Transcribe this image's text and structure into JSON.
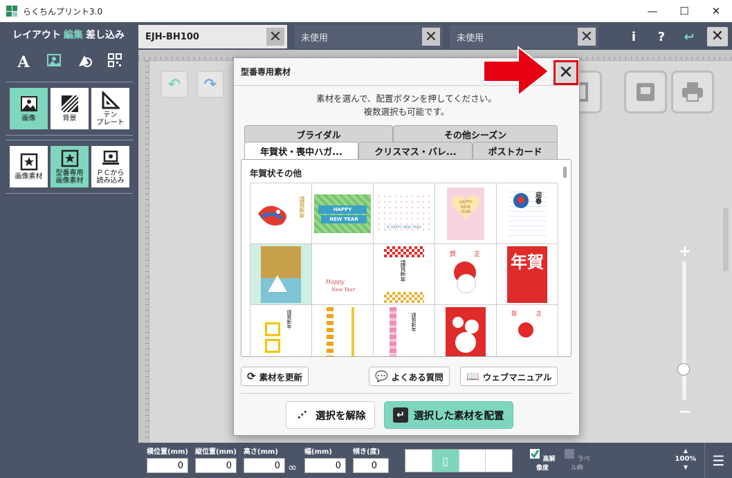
{
  "window": {
    "title": "らくちんプリント3.0",
    "controls": [
      "—",
      "☐",
      "✕"
    ]
  },
  "left_panel": {
    "mode_tabs": [
      {
        "label": "レイアウト",
        "active": false
      },
      {
        "label": "編集",
        "active": true
      },
      {
        "label": "差し込み",
        "active": false
      }
    ],
    "tool_icons": [
      "text-icon",
      "image-edit-icon",
      "shape-icon",
      "qr-code-icon"
    ],
    "group1": [
      {
        "label": "画像",
        "active": true
      },
      {
        "label": "背景",
        "active": false
      },
      {
        "label": "テン\nプレート",
        "active": false
      }
    ],
    "group2": [
      {
        "label": "画像素材",
        "active": false
      },
      {
        "label": "型番専用\n画像素材",
        "active": true
      },
      {
        "label": "ＰＣから\n読み込み",
        "active": false
      }
    ]
  },
  "doc_tabs": [
    {
      "label": "EJH-BH100",
      "active": true
    },
    {
      "label": "未使用",
      "active": false
    },
    {
      "label": "未使用",
      "active": false
    }
  ],
  "top_right_buttons": [
    "i",
    "?",
    "↩",
    "✕"
  ],
  "dialog": {
    "title": "型番専用素材",
    "message_line1": "素材を選んで、配置ボタンを押してください。",
    "message_line2": "複数選択も可能です。",
    "tabs_row1": [
      "ブライダル",
      "その他シーズン"
    ],
    "tabs_row2": [
      "年賀状・喪中ハガ...",
      "クリスマス・バレ...",
      "ポストカード"
    ],
    "active_tab": "年賀状・喪中ハガ...",
    "section_heading": "年賀状その他",
    "thumbnails": [
      {
        "kind": "koi",
        "text": "謹賀新年"
      },
      {
        "kind": "green-banner",
        "line1": "HAPPY",
        "line2": "NEW YEAR"
      },
      {
        "kind": "dotted",
        "text": "A HAPPY NEW YEAR"
      },
      {
        "kind": "pink-heart",
        "line1": "HAPPY",
        "line2": "NEW",
        "line3": "YEAR"
      },
      {
        "kind": "geigei",
        "text": "迎春"
      },
      {
        "kind": "mountain",
        "selected": true
      },
      {
        "kind": "script",
        "line1": "Happy",
        "line2": "New Year"
      },
      {
        "kind": "checker",
        "text": "謹賀新年"
      },
      {
        "kind": "sun-red",
        "left": "賀",
        "right": "正"
      },
      {
        "kind": "big-red",
        "text": "年賀"
      },
      {
        "kind": "yellow-frame",
        "text": "謹賀新年"
      },
      {
        "kind": "orange-strip",
        "text": ""
      },
      {
        "kind": "pink-strip",
        "text": "謹賀新年"
      },
      {
        "kind": "red-lace",
        "text": ""
      },
      {
        "kind": "red-sun-small",
        "left": "賀",
        "right": "正"
      }
    ],
    "refresh_button": "素材を更新",
    "faq_button": "よくある質問",
    "manual_button": "ウェブマニュアル",
    "deselect_button": "選択を解除",
    "place_button": "選択した素材を配置"
  },
  "bottom_bar": {
    "fields": [
      {
        "label": "横位置(mm)",
        "value": "0"
      },
      {
        "label": "縦位置(mm)",
        "value": "0"
      },
      {
        "label": "高さ(mm)",
        "value": "0"
      },
      {
        "label": "幅(mm)",
        "value": "0"
      },
      {
        "label": "傾き(度)",
        "value": "0"
      }
    ],
    "high_res_label": "高解像度",
    "label_frame_label": "ラベル枠",
    "zoom": "100%"
  },
  "colors": {
    "accent": "#7fd6bf",
    "panel": "#4c5468",
    "alert": "#e60012"
  }
}
